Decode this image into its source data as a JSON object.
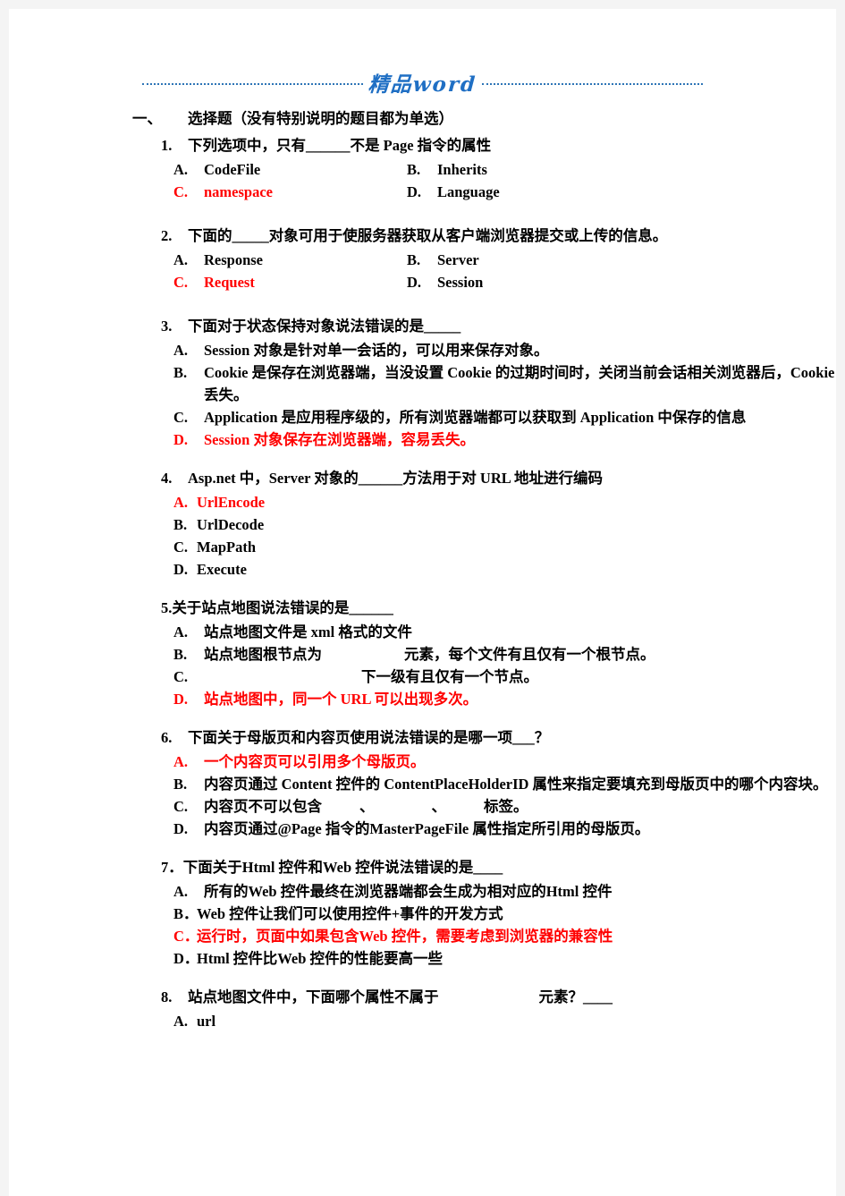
{
  "header": {
    "brand": "精品word"
  },
  "section": {
    "number": "一、",
    "title": "选择题（没有特别说明的题目都为单选）"
  },
  "questions": [
    {
      "num": "1.",
      "stem": "下列选项中，只有______不是 Page 指令的属性",
      "layout": "two-col",
      "options": [
        {
          "letter": "A.",
          "text": "CodeFile",
          "answer": false
        },
        {
          "letter": "B.",
          "text": "Inherits",
          "answer": false
        },
        {
          "letter": "C.",
          "text": "namespace",
          "answer": true
        },
        {
          "letter": "D.",
          "text": "Language",
          "answer": false
        }
      ]
    },
    {
      "num": "2.",
      "stem": "下面的_____对象可用于使服务器获取从客户端浏览器提交或上传的信息。",
      "layout": "two-col",
      "options": [
        {
          "letter": "A.",
          "text": "Response",
          "answer": false
        },
        {
          "letter": "B.",
          "text": "Server",
          "answer": false
        },
        {
          "letter": "C.",
          "text": "Request",
          "answer": true
        },
        {
          "letter": "D.",
          "text": "Session",
          "answer": false
        }
      ]
    },
    {
      "num": "3.",
      "stem": "下面对于状态保持对象说法错误的是_____",
      "layout": "one-col",
      "options": [
        {
          "letter": "A.",
          "text": "Session 对象是针对单一会话的，可以用来保存对象。",
          "answer": false
        },
        {
          "letter": "B.",
          "text": "Cookie 是保存在浏览器端，当没设置 Cookie 的过期时间时，关闭当前会话相关浏览器后，Cookie 丢失。",
          "answer": false
        },
        {
          "letter": "C.",
          "text": "Application 是应用程序级的，所有浏览器端都可以获取到 Application 中保存的信息",
          "answer": false
        },
        {
          "letter": "D.",
          "text": "Session 对象保存在浏览器端，容易丢失。",
          "answer": true
        }
      ]
    },
    {
      "num": "4.",
      "stem": "Asp.net 中，Server 对象的______方法用于对 URL 地址进行编码",
      "layout": "one-col",
      "options": [
        {
          "letter": "A.",
          "text": "UrlEncode",
          "answer": true,
          "narrow": true
        },
        {
          "letter": "B.",
          "text": "UrlDecode",
          "answer": false,
          "narrow": true
        },
        {
          "letter": "C.",
          "text": "MapPath",
          "answer": false,
          "narrow": true
        },
        {
          "letter": "D.",
          "text": "Execute",
          "answer": false,
          "narrow": true
        }
      ]
    },
    {
      "num": "5.",
      "tight": true,
      "stem": "关于站点地图说法错误的是______",
      "layout": "one-col",
      "options": [
        {
          "letter": "A.",
          "text": "站点地图文件是 xml 格式的文件",
          "answer": false
        },
        {
          "letter": "B.",
          "text": "站点地图根节点为",
          "answer": false,
          "gap_after": "gap-lg",
          "text2": "元素，每个文件有且仅有一个根节点。"
        },
        {
          "letter": "C.",
          "text": "",
          "answer": false,
          "gap_before": "gap-md",
          "text2": "下一级有且仅有一个",
          "gap_after": "gap-xl",
          "text3": "节点。"
        },
        {
          "letter": "D.",
          "text": "站点地图中，同一个 URL 可以出现多次。",
          "answer": true
        }
      ]
    },
    {
      "num": "6.",
      "stem": "下面关于母版页和内容页使用说法错误的是哪一项___？",
      "layout": "one-col",
      "options": [
        {
          "letter": "A.",
          "text": "一个内容页可以引用多个母版页。",
          "answer": true
        },
        {
          "letter": "B.",
          "text": "内容页通过 Content 控件的 ContentPlaceHolderID 属性来指定要填充到母版页中的哪个内容块。",
          "answer": false
        },
        {
          "letter": "C.",
          "text": "内容页不可以包含",
          "answer": false,
          "gap_after": "gap-sm",
          "text2": "、",
          "gap_after2": "gap-md",
          "text3": "、",
          "gap_after3": "gap-sm",
          "text4": "标签。"
        },
        {
          "letter": "D.",
          "text": "内容页通过@Page 指令的MasterPageFile 属性指定所引用的母版页。",
          "answer": false
        }
      ]
    },
    {
      "num": "7．",
      "tight": true,
      "stem": "下面关于Html 控件和Web 控件说法错误的是____",
      "layout": "one-col",
      "options": [
        {
          "letter": "A.",
          "text": " 所有的Web 控件最终在浏览器端都会生成为相对应的Html 控件",
          "answer": false
        },
        {
          "letter": "B．",
          "text": "Web 控件让我们可以使用控件+事件的开发方式",
          "answer": false,
          "narrow": true
        },
        {
          "letter": "C．",
          "text": "运行时，页面中如果包含Web 控件，需要考虑到浏览器的兼容性",
          "answer": true,
          "narrow": true
        },
        {
          "letter": "D．",
          "text": "Html 控件比Web 控件的性能要高一些",
          "answer": false,
          "narrow": true
        }
      ]
    },
    {
      "num": "8.",
      "stem": "站点地图文件中，下面哪个属性不属于",
      "stem_gap": "gap-xl",
      "stem2": "元素？____",
      "layout": "one-col",
      "options": [
        {
          "letter": "A.",
          "text": "url",
          "answer": false,
          "narrow": true
        }
      ]
    }
  ]
}
